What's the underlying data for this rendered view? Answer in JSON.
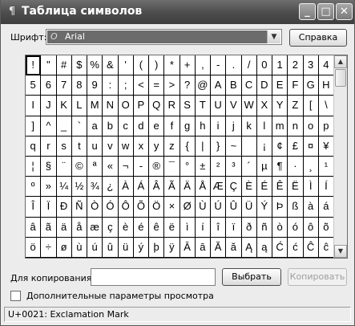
{
  "window": {
    "title": "Таблица символов",
    "icons": {
      "app": "char-map-icon",
      "minimize": "minimize-icon",
      "maximize": "maximize-icon",
      "close": "close-icon"
    }
  },
  "font": {
    "label": "Шрифт:",
    "selected": "Arial",
    "glyph": "O"
  },
  "buttons": {
    "help": "Справка",
    "select": "Выбрать",
    "copy": "Копировать"
  },
  "copy": {
    "label": "Для копирования:",
    "value": ""
  },
  "advanced": {
    "label": "Дополнительные параметры просмотра",
    "checked": false
  },
  "status": "U+0021: Exclamation Mark",
  "chars": [
    "!",
    "\"",
    "#",
    "$",
    "%",
    "&",
    "'",
    "(",
    ")",
    "*",
    "+",
    ",",
    "-",
    ".",
    "/",
    "0",
    "1",
    "2",
    "3",
    "4",
    "5",
    "6",
    "7",
    "8",
    "9",
    ":",
    ";",
    "<",
    "=",
    ">",
    "?",
    "@",
    "A",
    "B",
    "C",
    "D",
    "E",
    "F",
    "G",
    "H",
    "I",
    "J",
    "K",
    "L",
    "M",
    "N",
    "O",
    "P",
    "Q",
    "R",
    "S",
    "T",
    "U",
    "V",
    "W",
    "X",
    "Y",
    "Z",
    "[",
    "\\",
    "]",
    "^",
    "_",
    "`",
    "a",
    "b",
    "c",
    "d",
    "e",
    "f",
    "g",
    "h",
    "i",
    "j",
    "k",
    "l",
    "m",
    "n",
    "o",
    "p",
    "q",
    "r",
    "s",
    "t",
    "u",
    "v",
    "w",
    "x",
    "y",
    "z",
    "{",
    "|",
    "}",
    "~",
    " ",
    "¡",
    "¢",
    "£",
    "¤",
    "¥",
    "¦",
    "§",
    "¨",
    "©",
    "ª",
    "«",
    "¬",
    "-",
    "®",
    "¯",
    "°",
    "±",
    "²",
    "³",
    "´",
    "µ",
    "¶",
    "·",
    "¸",
    "¹",
    "º",
    "»",
    "¼",
    "½",
    "¾",
    "¿",
    "À",
    "Á",
    "Â",
    "Ã",
    "Ä",
    "Å",
    "Æ",
    "Ç",
    "È",
    "É",
    "Ê",
    "Ë",
    "Ì",
    "Í",
    "Î",
    "Ï",
    "Ð",
    "Ñ",
    "Ò",
    "Ó",
    "Ô",
    "Õ",
    "Ö",
    "×",
    "Ø",
    "Ù",
    "Ú",
    "Û",
    "Ü",
    "Ý",
    "Þ",
    "ß",
    "à",
    "á",
    "â",
    "ã",
    "ä",
    "å",
    "æ",
    "ç",
    "è",
    "é",
    "ê",
    "ë",
    "ì",
    "í",
    "î",
    "ï",
    "ð",
    "ñ",
    "ò",
    "ó",
    "ô",
    "õ",
    "ö",
    "÷",
    "ø",
    "ù",
    "ú",
    "û",
    "ü",
    "ý",
    "þ",
    "ÿ",
    "Ā",
    "ā",
    "Ă",
    "ă",
    "Ą",
    "ą",
    "Ć",
    "ć",
    "Ĉ",
    "ĉ"
  ]
}
